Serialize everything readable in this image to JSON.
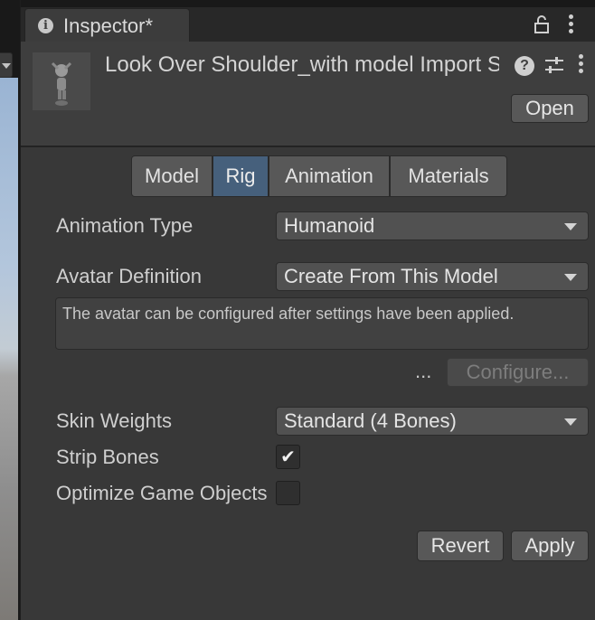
{
  "tab": {
    "title": "Inspector*"
  },
  "header": {
    "asset_title": "Look Over Shoulder_with model Import Settings",
    "open_label": "Open"
  },
  "segments": [
    "Model",
    "Rig",
    "Animation",
    "Materials"
  ],
  "active_segment": "Rig",
  "rig": {
    "animation_type": {
      "label": "Animation Type",
      "value": "Humanoid"
    },
    "avatar_definition": {
      "label": "Avatar Definition",
      "value": "Create From This Model"
    },
    "help_text": "The avatar can be configured after settings have been applied.",
    "dots": "...",
    "configure_label": "Configure...",
    "skin_weights": {
      "label": "Skin Weights",
      "value": "Standard (4 Bones)"
    },
    "strip_bones": {
      "label": "Strip Bones",
      "checked": true,
      "mark": "✔"
    },
    "optimize": {
      "label": "Optimize Game Objects",
      "checked": false
    }
  },
  "footer": {
    "revert_label": "Revert",
    "apply_label": "Apply"
  },
  "colors": {
    "panel": "#383838",
    "active_tab": "#46607c",
    "button": "#585858"
  }
}
